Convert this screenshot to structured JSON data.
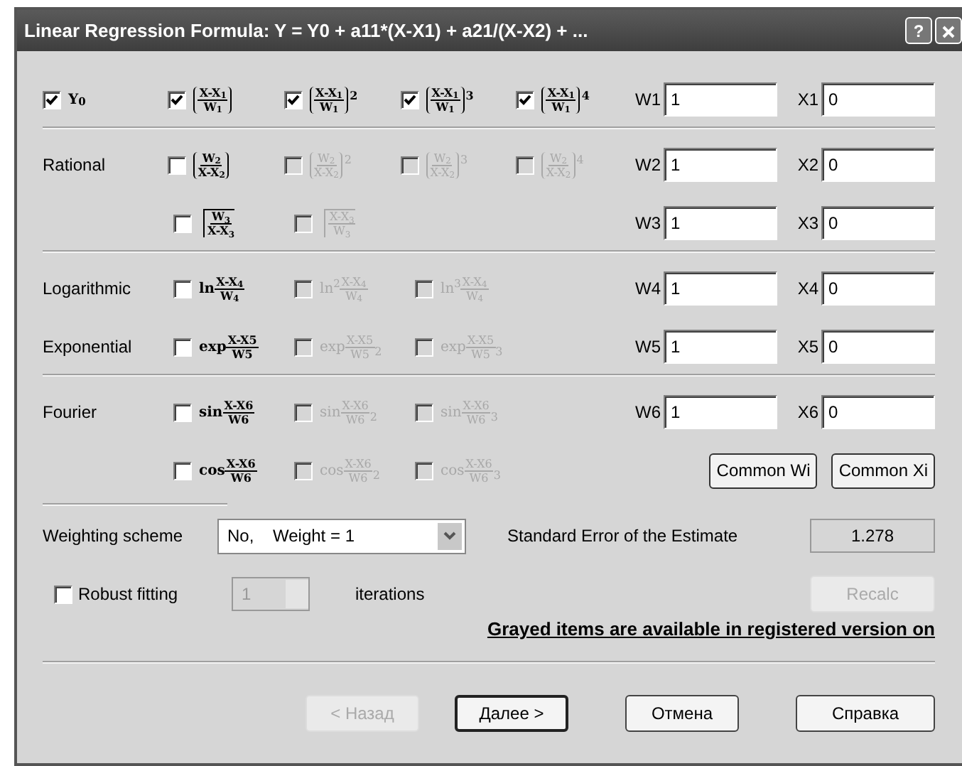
{
  "window": {
    "title": "Linear Regression Formula: Y = Y0 + a11*(X-X1) + a21/(X-X2) + ...",
    "help_button": "?"
  },
  "sections": [
    {
      "rows": [
        {
          "lead_term": {
            "kind": "plain",
            "text": "Y$_{0}$",
            "checked": true,
            "disabled": false
          },
          "terms": [
            {
              "kind": "paren",
              "num": "X-X$_{1}$",
              "den": "W$_{1}$",
              "checked": true,
              "disabled": false
            },
            {
              "kind": "paren",
              "num": "X-X$_{1}$",
              "den": "W$_{1}$",
              "power": "2",
              "checked": true,
              "disabled": false
            },
            {
              "kind": "paren",
              "num": "X-X$_{1}$",
              "den": "W$_{1}$",
              "power": "3",
              "checked": true,
              "disabled": false
            },
            {
              "kind": "paren",
              "num": "X-X$_{1}$",
              "den": "W$_{1}$",
              "power": "4",
              "checked": true,
              "disabled": false
            }
          ],
          "w": {
            "label": "W1",
            "value": "1"
          },
          "x": {
            "label": "X1",
            "value": "0"
          }
        }
      ]
    },
    {
      "rows": [
        {
          "label": "Rational",
          "terms": [
            {
              "kind": "paren",
              "num": "W$_{2}$",
              "den": "X-X$_{2}$",
              "checked": false,
              "disabled": false
            },
            {
              "kind": "paren",
              "num": "W$_{2}$",
              "den": "X-X$_{2}$",
              "power": "2",
              "checked": false,
              "disabled": true
            },
            {
              "kind": "paren",
              "num": "W$_{2}$",
              "den": "X-X$_{2}$",
              "power": "3",
              "checked": false,
              "disabled": true
            },
            {
              "kind": "paren",
              "num": "W$_{2}$",
              "den": "X-X$_{2}$",
              "power": "4",
              "checked": false,
              "disabled": true
            }
          ],
          "w": {
            "label": "W2",
            "value": "1"
          },
          "x": {
            "label": "X2",
            "value": "0"
          }
        },
        {
          "terms": [
            {
              "kind": "root",
              "num": "W$_{3}$",
              "den": "X-X$_{3}$",
              "checked": false,
              "disabled": false
            },
            {
              "kind": "root",
              "num": "X-X$_{3}$",
              "den": "W$_{3}$",
              "checked": false,
              "disabled": true
            }
          ],
          "w": {
            "label": "W3",
            "value": "1"
          },
          "x": {
            "label": "X3",
            "value": "0"
          }
        }
      ]
    },
    {
      "rows": [
        {
          "label": "Logarithmic",
          "terms": [
            {
              "kind": "func",
              "func": "ln",
              "num": "X-X$_{4}$",
              "den": "W$_{4}$",
              "checked": false,
              "disabled": false
            },
            {
              "kind": "func",
              "func": "ln$^{2}$",
              "num": "X-X$_{4}$",
              "den": "W$_{4}$",
              "checked": false,
              "disabled": true
            },
            {
              "kind": "func",
              "func": "ln$^{3}$",
              "num": "X-X$_{4}$",
              "den": "W$_{4}$",
              "checked": false,
              "disabled": true
            }
          ],
          "w": {
            "label": "W4",
            "value": "1"
          },
          "x": {
            "label": "X4",
            "value": "0"
          }
        },
        {
          "label": "Exponential",
          "terms": [
            {
              "kind": "func",
              "func": "exp",
              "num": "X-X5",
              "den": "W5",
              "checked": false,
              "disabled": false
            },
            {
              "kind": "func",
              "func": "exp",
              "num": "X-X5",
              "den": "W5",
              "suffix": "2",
              "checked": false,
              "disabled": true
            },
            {
              "kind": "func",
              "func": "exp",
              "num": "X-X5",
              "den": "W5",
              "suffix": "3",
              "checked": false,
              "disabled": true
            }
          ],
          "w": {
            "label": "W5",
            "value": "1"
          },
          "x": {
            "label": "X5",
            "value": "0"
          }
        }
      ]
    },
    {
      "rows": [
        {
          "label": "Fourier",
          "terms": [
            {
              "kind": "func",
              "func": "sin",
              "num": "X-X6",
              "den": "W6",
              "checked": false,
              "disabled": false
            },
            {
              "kind": "func",
              "func": "sin",
              "num": "X-X6",
              "den": "W6",
              "suffix": "2",
              "checked": false,
              "disabled": true
            },
            {
              "kind": "func",
              "func": "sin",
              "num": "X-X6",
              "den": "W6",
              "suffix": "3",
              "checked": false,
              "disabled": true
            }
          ],
          "w": {
            "label": "W6",
            "value": "1"
          },
          "x": {
            "label": "X6",
            "value": "0"
          }
        },
        {
          "terms": [
            {
              "kind": "func",
              "func": "cos",
              "num": "X-X6",
              "den": "W6",
              "checked": false,
              "disabled": false
            },
            {
              "kind": "func",
              "func": "cos",
              "num": "X-X6",
              "den": "W6",
              "suffix": "2",
              "checked": false,
              "disabled": true
            },
            {
              "kind": "func",
              "func": "cos",
              "num": "X-X6",
              "den": "W6",
              "suffix": "3",
              "checked": false,
              "disabled": true
            }
          ],
          "buttons": [
            "Common Wi",
            "Common Xi"
          ]
        }
      ]
    }
  ],
  "weighting": {
    "label": "Weighting scheme",
    "value": "No,    Weight = 1"
  },
  "std_error": {
    "label": "Standard Error of the Estimate",
    "value": "1.278"
  },
  "robust": {
    "label": "Robust fitting",
    "checked": false,
    "iterations": "1",
    "iterations_disabled": true,
    "unit": "iterations"
  },
  "recalc": {
    "label": "Recalc",
    "disabled": true
  },
  "note": "Grayed items are available in registered version on",
  "buttons": [
    {
      "label": "< Назад",
      "disabled": true,
      "default": false
    },
    {
      "label": "Далее >",
      "disabled": false,
      "default": true
    },
    {
      "label": "Отмена",
      "disabled": false,
      "default": false
    },
    {
      "label": "Справка",
      "disabled": false,
      "default": false
    }
  ]
}
